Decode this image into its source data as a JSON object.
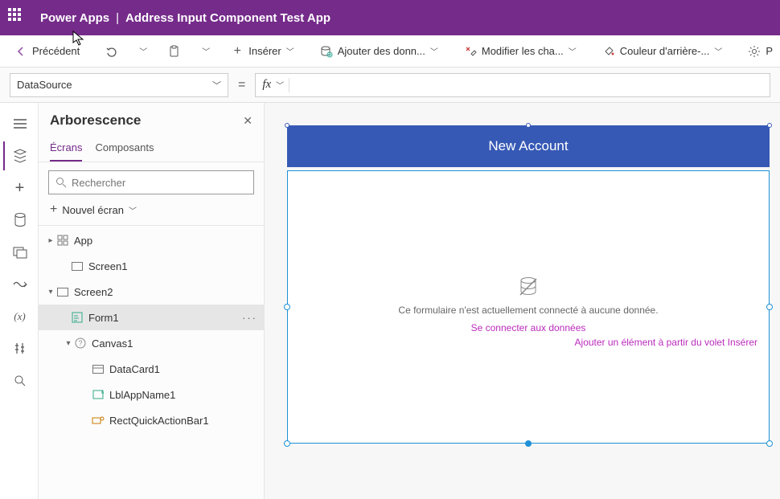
{
  "title": {
    "app": "Power Apps",
    "file": "Address Input Component Test App"
  },
  "cmdbar": {
    "back": "Précédent",
    "insert": "Insérer",
    "addData": "Ajouter des donn...",
    "editFields": "Modifier les cha...",
    "bgColor": "Couleur d'arrière-...",
    "more": "P"
  },
  "formula": {
    "property": "DataSource",
    "eq": "="
  },
  "tree": {
    "title": "Arborescence",
    "tabs": {
      "screens": "Écrans",
      "components": "Composants"
    },
    "searchPlaceholder": "Rechercher",
    "newScreen": "Nouvel écran",
    "nodes": {
      "app": "App",
      "screen1": "Screen1",
      "screen2": "Screen2",
      "form1": "Form1",
      "canvas1": "Canvas1",
      "datacard1": "DataCard1",
      "lbl": "LblAppName1",
      "rect": "RectQuickActionBar1"
    }
  },
  "canvas": {
    "headerTitle": "New Account",
    "formMsg": "Ce formulaire n'est actuellement connecté à aucune donnée.",
    "connectLink": "Se connecter aux données",
    "addLink": "Ajouter un élément à partir du volet Insérer"
  }
}
